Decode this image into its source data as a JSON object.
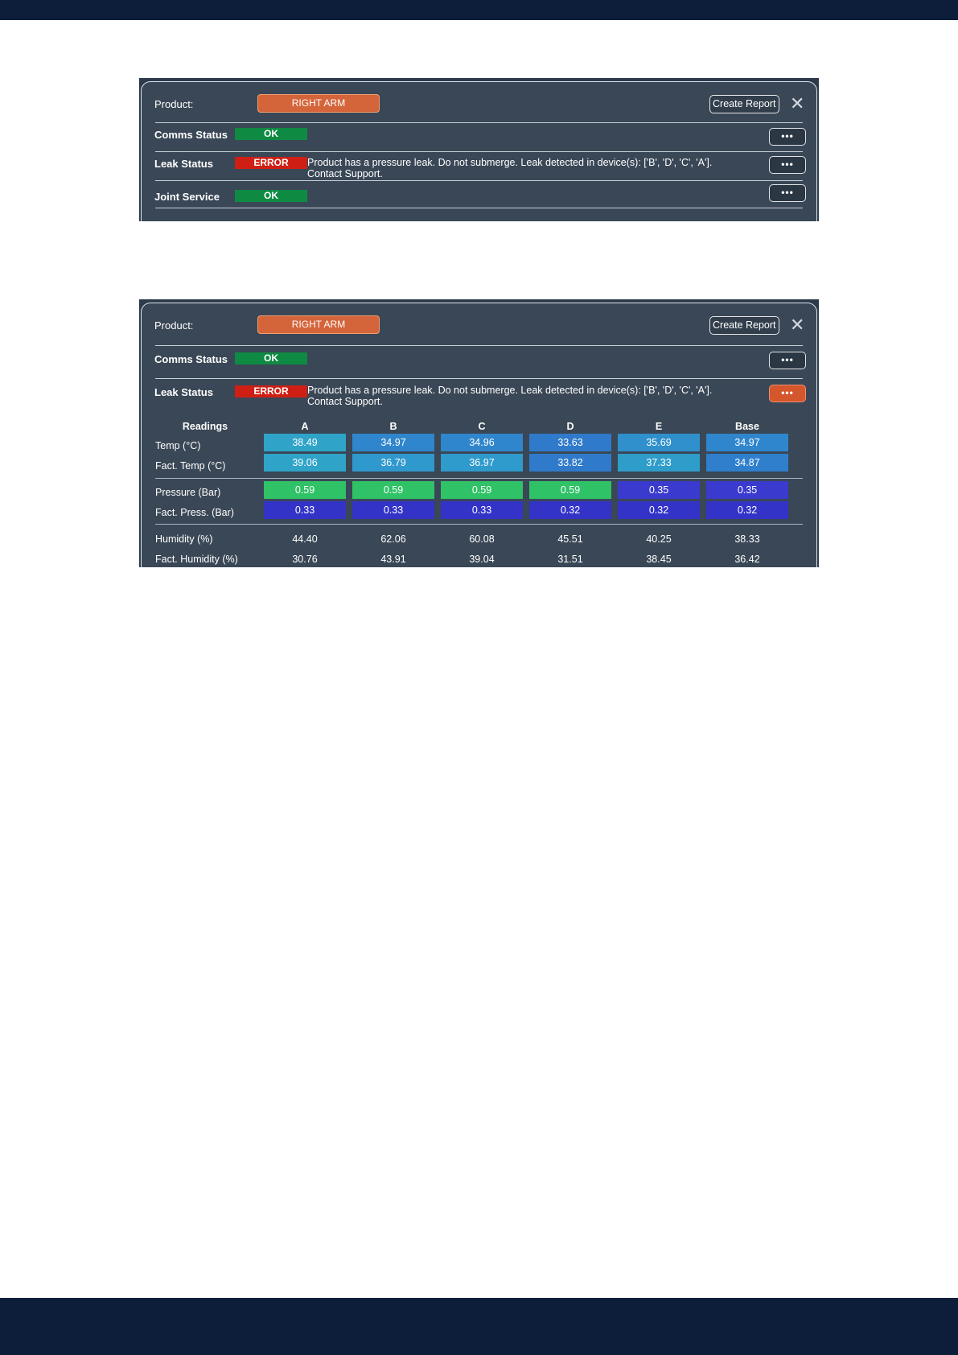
{
  "panel1": {
    "product_label": "Product:",
    "product_value": "RIGHT ARM",
    "create_report": "Create Report",
    "rows": [
      {
        "label": "Comms Status",
        "status": "OK",
        "message": ""
      },
      {
        "label": "Leak Status",
        "status": "ERROR",
        "message": "Product has a pressure leak. Do not submerge.  Leak detected in device(s): ['B', 'D', 'C', 'A']. Contact Support."
      },
      {
        "label": "Joint Service",
        "status": "OK",
        "message": ""
      }
    ],
    "more": "•••"
  },
  "panel2": {
    "product_label": "Product:",
    "product_value": "RIGHT ARM",
    "create_report": "Create Report",
    "rows": [
      {
        "label": "Comms Status",
        "status": "OK",
        "message": ""
      },
      {
        "label": "Leak Status",
        "status": "ERROR",
        "message": "Product has a pressure leak. Do not submerge.  Leak detected in device(s): ['B', 'D', 'C', 'A']. Contact Support."
      }
    ],
    "more": "•••",
    "readings": {
      "header": "Readings",
      "columns": [
        "A",
        "B",
        "C",
        "D",
        "E",
        "Base"
      ],
      "rows": [
        {
          "label": "Temp (°C)",
          "values": [
            "38.49",
            "34.97",
            "34.96",
            "33.63",
            "35.69",
            "34.97"
          ]
        },
        {
          "label": "Fact. Temp (°C)",
          "values": [
            "39.06",
            "36.79",
            "36.97",
            "33.82",
            "37.33",
            "34.87"
          ]
        },
        {
          "label": "Pressure (Bar)",
          "values": [
            "0.59",
            "0.59",
            "0.59",
            "0.59",
            "0.35",
            "0.35"
          ]
        },
        {
          "label": "Fact. Press. (Bar)",
          "values": [
            "0.33",
            "0.33",
            "0.33",
            "0.32",
            "0.32",
            "0.32"
          ]
        },
        {
          "label": "Humidity (%)",
          "values": [
            "44.40",
            "62.06",
            "60.08",
            "45.51",
            "40.25",
            "38.33"
          ]
        },
        {
          "label": "Fact. Humidity (%)",
          "values": [
            "30.76",
            "43.91",
            "39.04",
            "31.51",
            "38.45",
            "36.42"
          ]
        }
      ]
    }
  },
  "colors": {
    "ok": "#0f8a43",
    "error": "#cf1f14",
    "product": "#d4643a",
    "temp_teal": "#2fa3c8",
    "temp_blue": "#2f7fcc",
    "pressure_green": "#2fc266",
    "pressure_indigo": "#3a3acf",
    "fact_press": "#3333c8"
  }
}
